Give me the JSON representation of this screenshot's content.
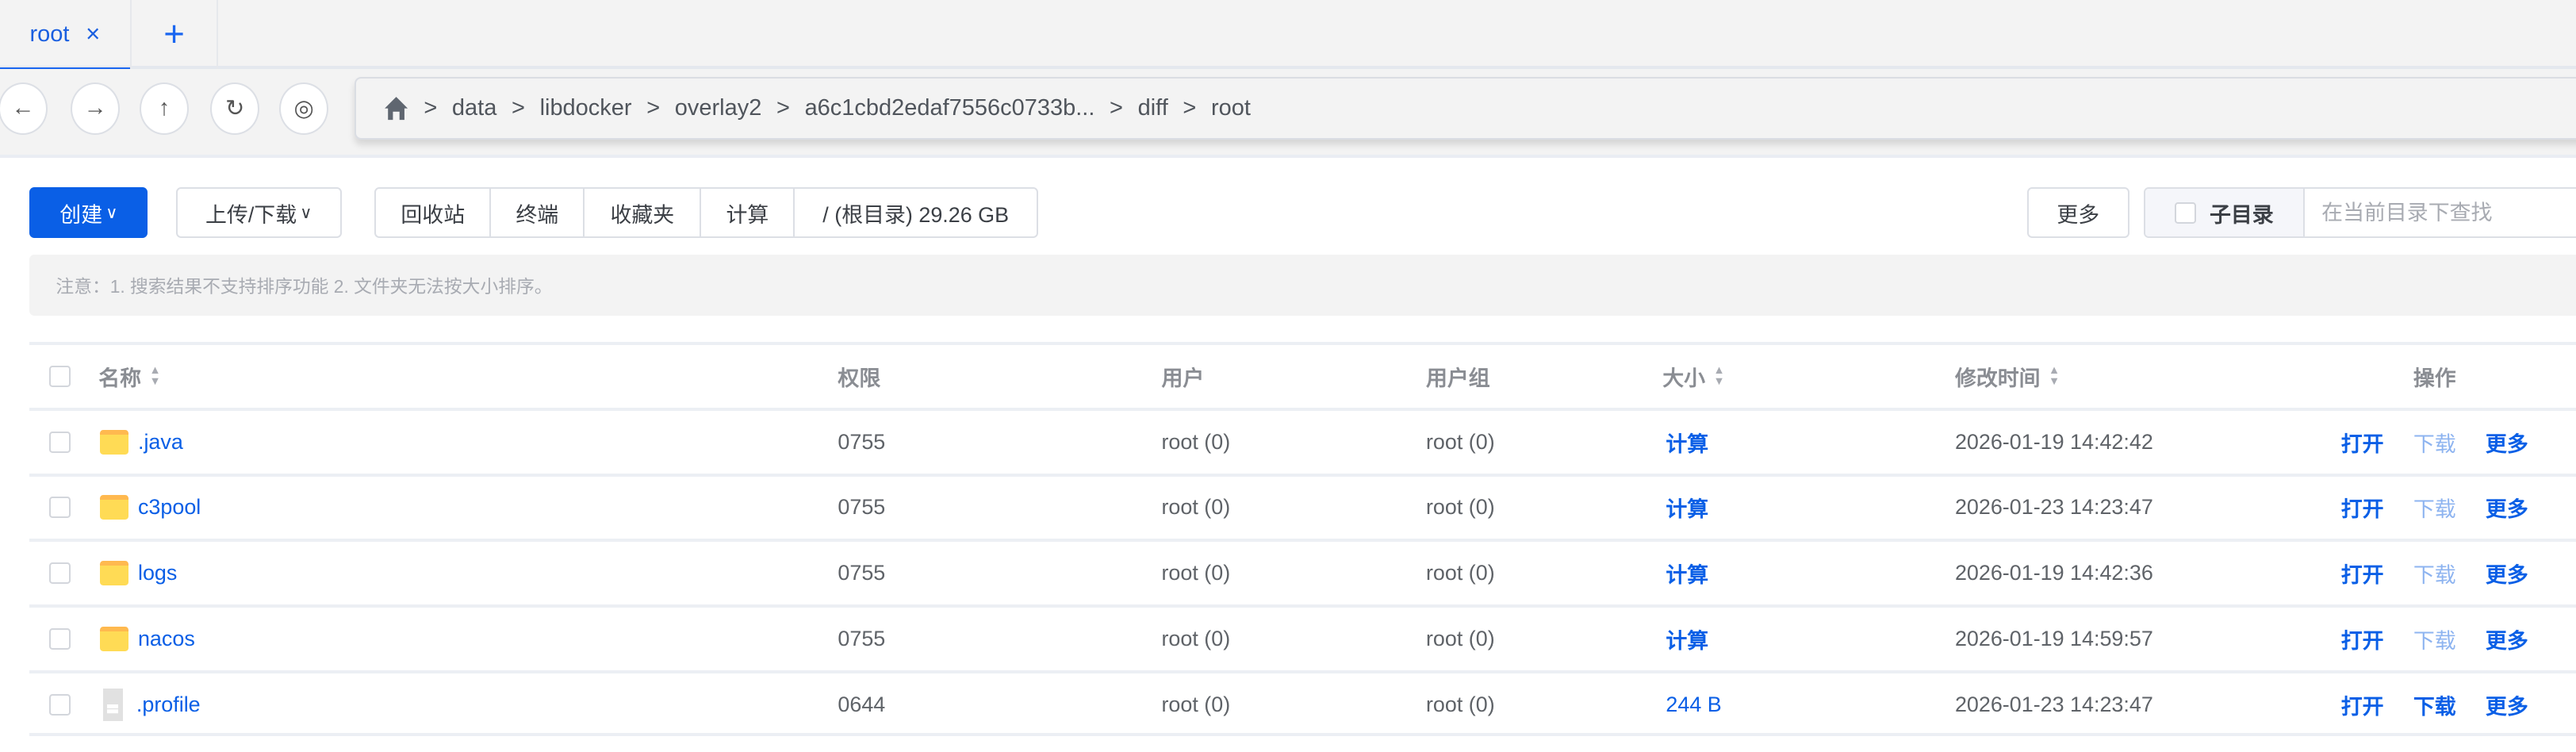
{
  "tabs": [
    {
      "label": "root",
      "close": "×"
    },
    {
      "label": "+"
    }
  ],
  "nav": {
    "back": "←",
    "forward": "→",
    "up": "↑",
    "refresh": "↻",
    "view": "◎"
  },
  "breadcrumb": [
    "data",
    "libdocker",
    "overlay2",
    "a6c1cbd2edaf7556c0733b...",
    "diff",
    "root"
  ],
  "breadcrumb_sep": ">",
  "toolbar": {
    "create": "创建",
    "upload_download": "上传/下载",
    "recycle": "回收站",
    "terminal": "终端",
    "favorites": "收藏夹",
    "calculate": "计算",
    "disk": "/ (根目录) 29.26 GB",
    "more": "更多",
    "subdir": "子目录",
    "search_placeholder": "在当前目录下查找"
  },
  "notice": "注意：1. 搜索结果不支持排序功能 2. 文件夹无法按大小排序。",
  "columns": {
    "name": "名称",
    "perm": "权限",
    "user": "用户",
    "group": "用户组",
    "size": "大小",
    "mtime": "修改时间",
    "ops": "操作"
  },
  "actions": {
    "open": "打开",
    "download": "下载",
    "more": "更多"
  },
  "rows": [
    {
      "name": ".java",
      "type": "folder",
      "perm": "0755",
      "user": "root (0)",
      "group": "root (0)",
      "size": "计算",
      "mtime": "2026-01-19 14:42:42"
    },
    {
      "name": "c3pool",
      "type": "folder",
      "perm": "0755",
      "user": "root (0)",
      "group": "root (0)",
      "size": "计算",
      "mtime": "2026-01-23 14:23:47"
    },
    {
      "name": "logs",
      "type": "folder",
      "perm": "0755",
      "user": "root (0)",
      "group": "root (0)",
      "size": "计算",
      "mtime": "2026-01-19 14:42:36"
    },
    {
      "name": "nacos",
      "type": "folder",
      "perm": "0755",
      "user": "root (0)",
      "group": "root (0)",
      "size": "计算",
      "mtime": "2026-01-19 14:59:57"
    },
    {
      "name": ".profile",
      "type": "file",
      "perm": "0644",
      "user": "root (0)",
      "group": "root (0)",
      "size": "244 B",
      "mtime": "2026-01-23 14:23:47"
    }
  ]
}
